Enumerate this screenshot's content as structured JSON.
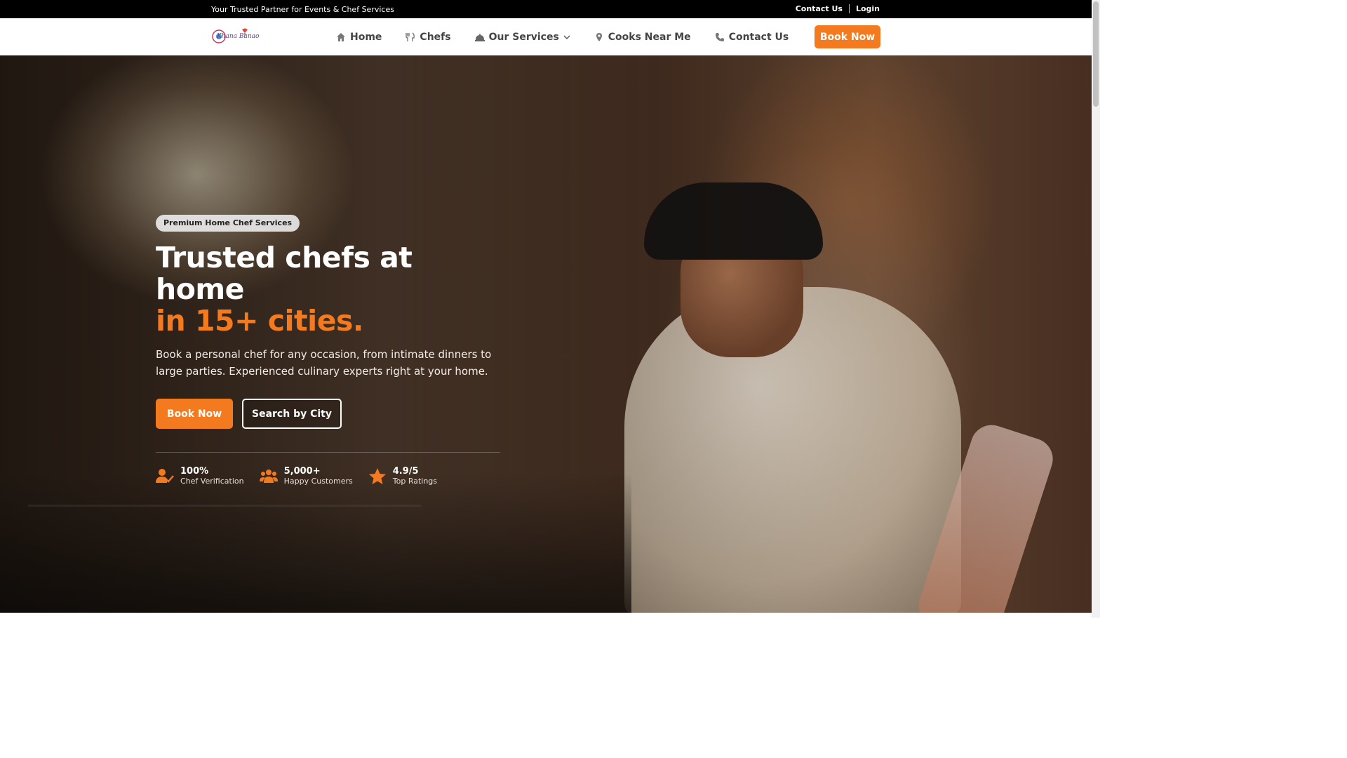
{
  "topbar": {
    "tagline": "Your Trusted Partner for Events & Chef Services",
    "contact_label": "Contact Us",
    "login_label": "Login"
  },
  "nav": {
    "logo_text": "Khana Banao",
    "items": [
      {
        "label": "Home",
        "icon": "home-icon"
      },
      {
        "label": "Chefs",
        "icon": "utensils-icon"
      },
      {
        "label": "Our Services",
        "icon": "cloche-icon",
        "has_dropdown": true
      },
      {
        "label": "Cooks Near Me",
        "icon": "map-pin-icon"
      },
      {
        "label": "Contact Us",
        "icon": "phone-icon"
      }
    ],
    "cta_label": "Book Now"
  },
  "hero": {
    "badge": "Premium Home Chef Services",
    "title_line1": "Trusted chefs at home",
    "title_line2": "in 15+ cities.",
    "description": "Book a personal chef for any occasion, from intimate dinners to large parties. Experienced culinary experts right at your home.",
    "primary_button": "Book Now",
    "secondary_button": "Search by City",
    "stats": [
      {
        "value": "100%",
        "label": "Chef Verification",
        "icon": "user-check-icon"
      },
      {
        "value": "5,000+",
        "label": "Happy Customers",
        "icon": "users-icon"
      },
      {
        "value": "4.9/5",
        "label": "Top Ratings",
        "icon": "star-icon"
      }
    ]
  },
  "colors": {
    "accent": "#f47a1f",
    "topbar_bg": "#000000"
  }
}
